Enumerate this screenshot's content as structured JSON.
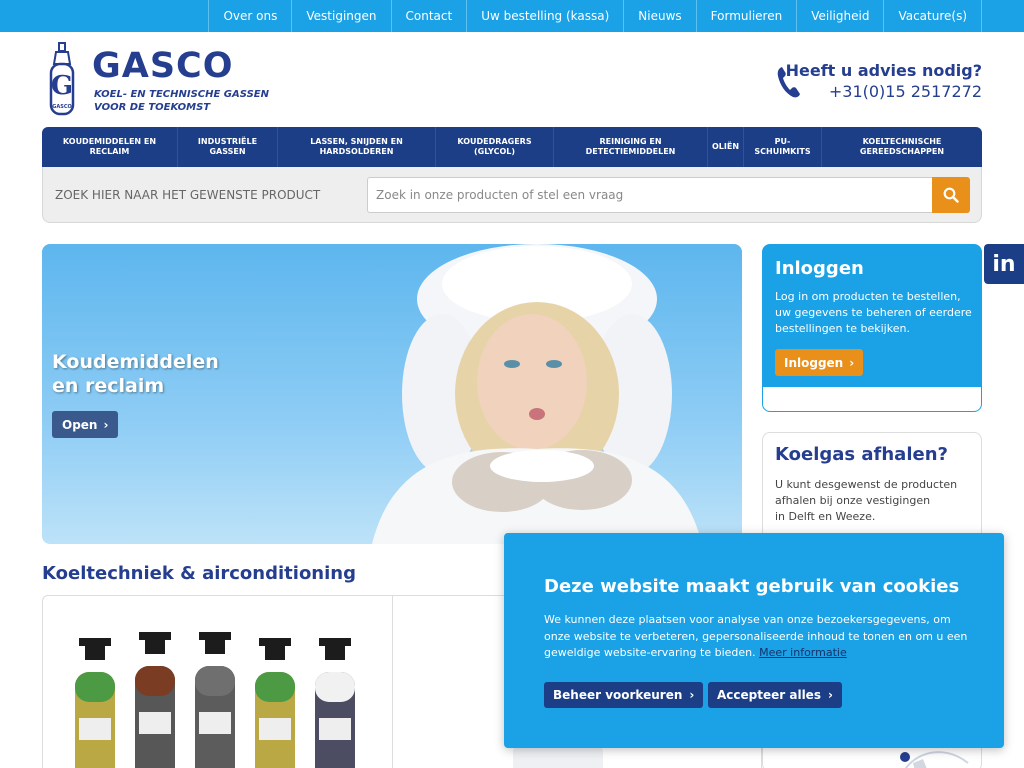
{
  "topnav": [
    "Over ons",
    "Vestigingen",
    "Contact",
    "Uw bestelling (kassa)",
    "Nieuws",
    "Formulieren",
    "Veiligheid",
    "Vacature(s)"
  ],
  "logo": {
    "name": "GASCO",
    "tagline1": "KOEL- EN TECHNISCHE GASSEN",
    "tagline2": "VOOR DE TOEKOMST",
    "emblem_text": "GASCO"
  },
  "advice": {
    "title": "Heeft u advies nodig?",
    "phone": "+31(0)15 2517272"
  },
  "mainnav": [
    {
      "line1": "KOUDEMIDDELEN EN",
      "line2": "RECLAIM"
    },
    {
      "line1": "INDUSTRIËLE",
      "line2": "GASSEN"
    },
    {
      "line1": "LASSEN, SNIJDEN EN",
      "line2": "HARDSOLDEREN"
    },
    {
      "line1": "KOUDEDRAGERS",
      "line2": "(GLYCOL)"
    },
    {
      "line1": "REINIGING EN",
      "line2": "DETECTIEMIDDELEN"
    },
    {
      "line1": "OLIËN",
      "line2": ""
    },
    {
      "line1": "PU-",
      "line2": "SCHUIMKITS"
    },
    {
      "line1": "KOELTECHNISCHE",
      "line2": "GEREEDSCHAPPEN"
    }
  ],
  "search": {
    "label": "ZOEK HIER NAAR HET GEWENSTE PRODUCT",
    "placeholder": "Zoek in onze producten of stel een vraag",
    "value": ""
  },
  "hero": {
    "title_line1": "Koudemiddelen",
    "title_line2": "en reclaim",
    "button": "Open"
  },
  "login": {
    "title": "Inloggen",
    "text": "Log in om producten te bestellen, uw gegevens te beheren of eerdere bestellingen te bekijken.",
    "button": "Inloggen"
  },
  "pickup": {
    "title": "Koelgas afhalen?",
    "text_line1": "U kunt desgewenst de producten",
    "text_line2": "afhalen bij onze vestigingen",
    "text_line3": "in Delft en Weeze."
  },
  "social": {
    "linkedin": "in"
  },
  "section": {
    "title": "Koeltechniek & airconditioning"
  },
  "cookie": {
    "title": "Deze website maakt gebruik van cookies",
    "text": "We kunnen deze plaatsen voor analyse van onze bezoekersgegevens, om onze website te verbeteren, gepersonaliseerde inhoud te tonen en om u een geweldige website-ervaring te bieden.",
    "link": "Meer informatie",
    "manage_button": "Beheer voorkeuren",
    "accept_button": "Accepteer alles"
  },
  "colors": {
    "topbar": "#1aa1e6",
    "navy": "#1c3e87",
    "brand": "#253e8f",
    "orange": "#e8901a"
  },
  "icons": {
    "search": "search-icon",
    "phone": "phone-icon",
    "chevron": "chevron-right-icon",
    "linkedin": "linkedin-icon"
  }
}
